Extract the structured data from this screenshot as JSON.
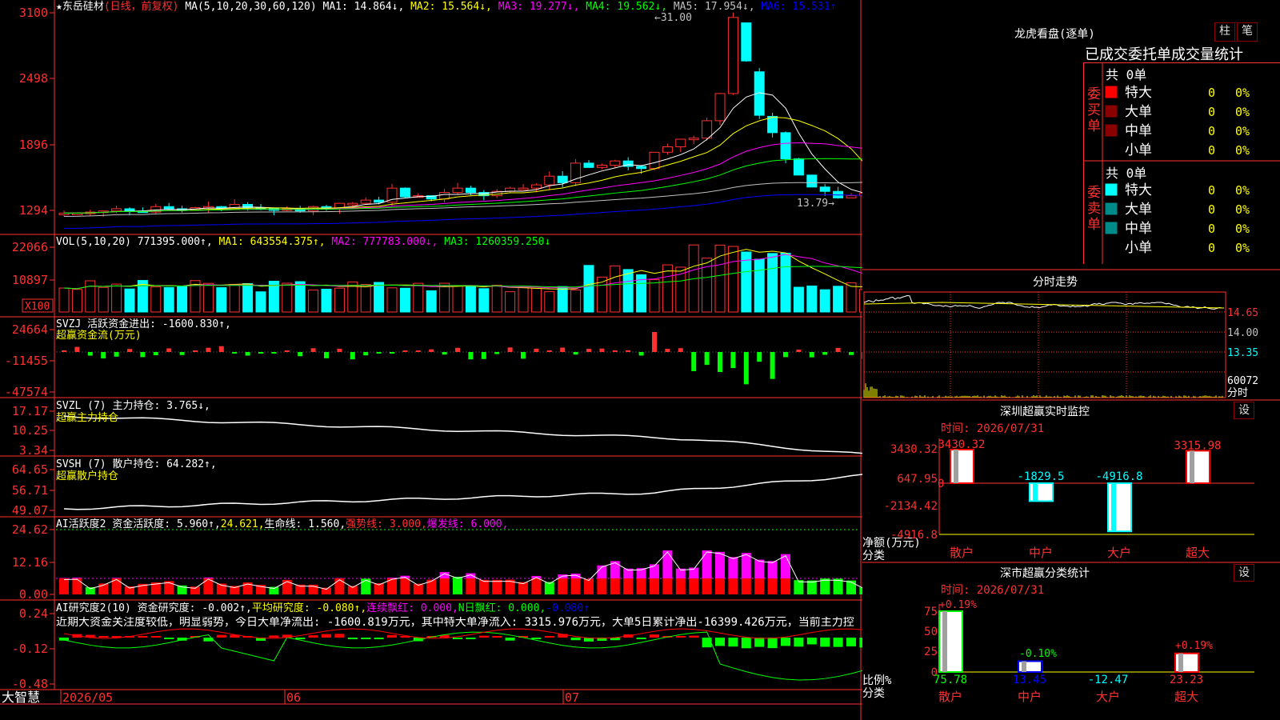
{
  "stock": {
    "name": "东岳硅材",
    "period_label": "(日线，前复权)",
    "ma_header": "MA(5,10,20,30,60,120)",
    "ma1": "MA1: 14.864↓,",
    "ma2": "MA2: 15.564↓,",
    "ma3": "MA3: 19.277↓,",
    "ma4": "MA4: 19.562↓,",
    "ma5": "MA5: 17.954↓,",
    "ma6": "MA6: 15.531↑",
    "high_label": "31.00",
    "low_label": "13.79",
    "price_ticks": [
      "3100",
      "2498",
      "1896",
      "1294"
    ]
  },
  "volume": {
    "header": "VOL(5,10,20)",
    "vol": "771395.000↑,",
    "ma1": "MA1: 643554.375↑,",
    "ma2": "MA2: 777783.000↓,",
    "ma3": "MA3: 1260359.250↓",
    "ticks": [
      "22066",
      "10897"
    ],
    "unit": "X100"
  },
  "svzj": {
    "header": "SVZJ  活跃资金进出: -1600.830↑,",
    "sub": "超赢资金流(万元)",
    "ticks": [
      "24664",
      "-11455",
      "-47574"
    ]
  },
  "svzl": {
    "header": "SVZL (7) 主力持仓: 3.765↓,",
    "sub": "超赢主力持仓",
    "ticks": [
      "17.17",
      "10.25",
      "3.34"
    ]
  },
  "svsh": {
    "header": "SVSH (7) 散户持仓: 64.282↑,",
    "sub": "超赢散户持仓",
    "ticks": [
      "64.65",
      "56.71",
      "49.07"
    ]
  },
  "ai_active": {
    "a": "AI活跃度2 资金活跃度: 5.960↑,",
    "b": "24.621,",
    "c": "生命线: 1.560,",
    "d": "强势线: 3.000,",
    "e": "爆发线: 6.000,",
    "ticks": [
      "24.62",
      "12.16",
      "0.00"
    ]
  },
  "ai_research": {
    "a": "AI研究度2(10) 资金研究度: -0.002↑,",
    "b": "平均研究度: -0.080↑,",
    "c": "连续飘红: 0.000,",
    "d": "N日飘红: 0.000,",
    "e": "-0.080↑",
    "comment": "近期大资金关注度较低，明显弱势，今日大单净流出: -1600.819万元，其中特大单净流入: 3315.976万元，大单5日累计净出-16399.426万元，当前主力控",
    "ticks": [
      "0.24",
      "-0.12",
      "-0.48"
    ]
  },
  "time_axis": {
    "brand": "大智慧",
    "labels": [
      "2026/05",
      "06",
      "07"
    ]
  },
  "dragon_tiger": {
    "title": "龙虎看盘(逐单)",
    "btn_zhu": "柱",
    "btn_bi": "笔",
    "subtitle": "已成交委托单成交量统计",
    "buy_label": "委买单",
    "sell_label": "委卖单",
    "buy_total": "共 0单",
    "sell_total": "共 0单",
    "buy_rows": [
      {
        "name": "特大",
        "count": "0",
        "pct": "0%"
      },
      {
        "name": "大单",
        "count": "0",
        "pct": "0%"
      },
      {
        "name": "中单",
        "count": "0",
        "pct": "0%"
      },
      {
        "name": "小单",
        "count": "0",
        "pct": "0%"
      }
    ],
    "sell_rows": [
      {
        "name": "特大",
        "count": "0",
        "pct": "0%"
      },
      {
        "name": "大单",
        "count": "0",
        "pct": "0%"
      },
      {
        "name": "中单",
        "count": "0",
        "pct": "0%"
      },
      {
        "name": "小单",
        "count": "0",
        "pct": "0%"
      }
    ],
    "buy_colors": [
      "#ff0000",
      "#8b0000",
      "#8b0000",
      "#000000"
    ],
    "sell_colors": [
      "#00ffff",
      "#008b8b",
      "#008b8b",
      "#000000"
    ]
  },
  "intraday": {
    "title": "分时走势",
    "ticks": [
      "14.65",
      "14.00",
      "13.35"
    ],
    "vol_tick": "60072",
    "vol_label": "分时"
  },
  "sz_monitor": {
    "title": "深圳超赢实时监控",
    "settings": "设",
    "time": "时间: 2026/07/31",
    "ticks": [
      "3430.32",
      "647.95",
      "-2134.42",
      "-4916.8"
    ],
    "zero": "0",
    "y_label": "净额(万元)",
    "x_label": "分类",
    "categories": [
      "散户",
      "中户",
      "大户",
      "超大"
    ],
    "values": [
      3430.32,
      -1829.5,
      -4916.8,
      3315.98
    ],
    "value_labels": [
      "3430.32",
      "-1829.5",
      "-4916.8",
      "3315.98"
    ]
  },
  "sz_class": {
    "title": "深市超赢分类统计",
    "settings": "设",
    "time": "时间: 2026/07/31",
    "ticks": [
      "75",
      "50",
      "25",
      "0"
    ],
    "y_label": "比例%",
    "x_label": "分类",
    "categories": [
      "散户",
      "中户",
      "大户",
      "超大"
    ],
    "values": [
      75.78,
      13.45,
      -12.47,
      23.23
    ],
    "value_labels": [
      "75.78",
      "13.45",
      "-12.47",
      "23.23"
    ],
    "change_labels": [
      "+0.19%",
      "-0.10%",
      "+0.19%"
    ]
  },
  "chart_data": [
    {
      "type": "candlestick",
      "title": "东岳硅材 (日线，前复权)",
      "y_ticks": [
        13.05,
        19.05,
        25.05,
        31.0
      ],
      "high": 31.0,
      "low": 13.79,
      "close_approx": [
        13.0,
        13.0,
        13.1,
        13.2,
        13.4,
        13.2,
        13.1,
        13.6,
        13.4,
        13.3,
        13.5,
        13.6,
        13.4,
        13.8,
        13.5,
        13.4,
        13.3,
        13.4,
        13.2,
        13.6,
        13.4,
        13.9,
        13.9,
        14.2,
        14.0,
        15.3,
        14.5,
        14.6,
        14.3,
        14.9,
        15.3,
        14.9,
        14.6,
        15.0,
        15.3,
        15.3,
        15.6,
        16.4,
        15.8,
        17.6,
        17.2,
        17.4,
        17.8,
        17.3,
        17.1,
        18.6,
        19.1,
        19.8,
        19.9,
        21.5,
        24.0,
        28.0,
        25.0,
        21.9,
        20.4,
        18.0,
        16.5,
        15.4,
        15.0,
        14.4,
        14.6,
        14.8,
        14.5,
        14.2,
        14.0,
        13.9
      ]
    },
    {
      "type": "bar",
      "title": "VOL(5,10,20)",
      "ylabel": "X100",
      "y_ticks": [
        10897,
        22066
      ]
    }
  ]
}
